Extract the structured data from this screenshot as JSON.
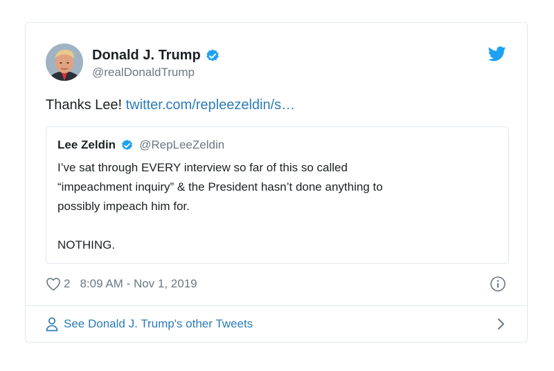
{
  "tweet": {
    "author_name": "Donald J. Trump",
    "author_handle": "@realDonaldTrump",
    "text": "Thanks Lee! ",
    "link_text": "twitter.com/repleezeldin/s…",
    "like_count": "2",
    "timestamp": "8:09 AM - Nov 1, 2019",
    "icons": {
      "verified": "verified-badge-icon",
      "brand": "twitter-bird-icon",
      "like": "heart-icon",
      "info": "info-icon",
      "profile": "person-icon",
      "more": "chevron-right-icon"
    }
  },
  "quote": {
    "author_name": "Lee Zeldin",
    "author_handle": "@RepLeeZeldin",
    "lines": [
      "I’ve sat through EVERY interview so far of this so called",
      "“impeachment inquiry” & the President hasn’t done anything to",
      "possibly impeach him for.",
      "NOTHING."
    ]
  },
  "footer": {
    "label": "See Donald J. Trump's other Tweets"
  },
  "colors": {
    "link": "#2b7bb9",
    "verified": "#1da1f2",
    "secondary_text": "#697882",
    "border": "#e1e8ed"
  }
}
